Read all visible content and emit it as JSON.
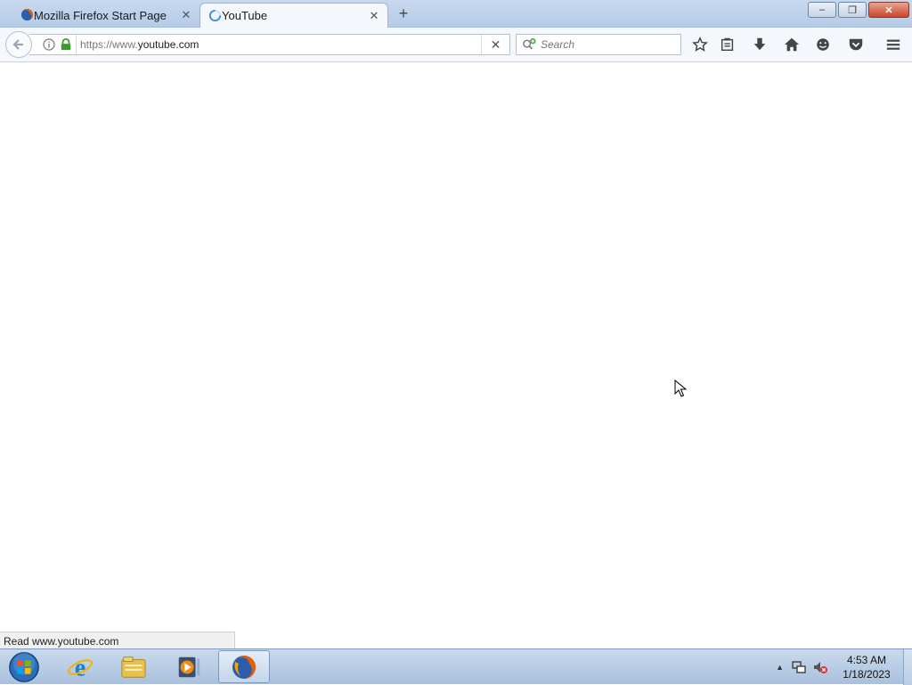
{
  "browser": {
    "tabs": [
      {
        "label": "Mozilla Firefox Start Page",
        "close_glyph": "✕"
      },
      {
        "label": "YouTube",
        "close_glyph": "✕"
      }
    ],
    "new_tab_glyph": "+",
    "window_controls": {
      "minimize": "–",
      "restore": "❐",
      "close": "✕"
    },
    "url_prefix": "https://www.",
    "url_host": "youtube.com",
    "stop_glyph": "✕",
    "search_placeholder": "Search",
    "toolbar_icons": [
      "bookmark-star-icon",
      "reading-list-icon",
      "downloads-icon",
      "home-icon",
      "hello-icon",
      "pocket-icon",
      "menu-icon"
    ],
    "status_text": "Read www.youtube.com"
  },
  "taskbar": {
    "apps": [
      "start-orb-icon",
      "internet-explorer-icon",
      "file-explorer-icon",
      "media-player-icon",
      "firefox-icon"
    ],
    "clock_time": "4:53 AM",
    "clock_date": "1/18/2023"
  },
  "colors": {
    "tabstrip": "#b5cbe6",
    "toolbar": "#f4f7fb",
    "taskbar": "#a9c1de",
    "lock_green": "#3c9a2e"
  }
}
